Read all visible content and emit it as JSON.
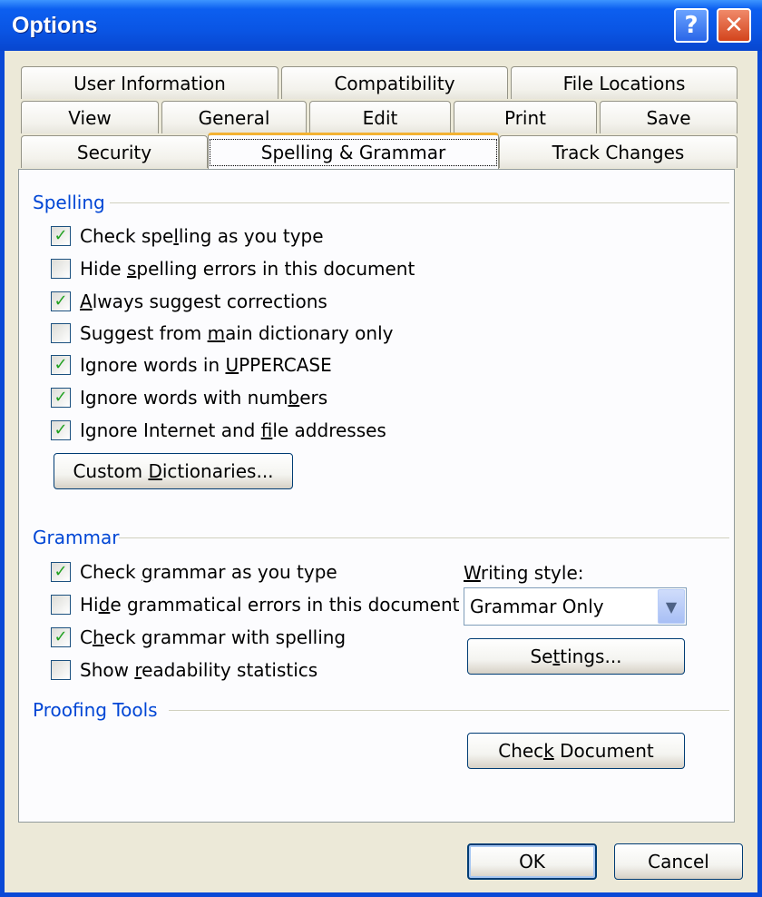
{
  "window": {
    "title": "Options"
  },
  "titlebar": {
    "help_glyph": "?",
    "close_glyph": "✕"
  },
  "tabs": {
    "row1": [
      "User Information",
      "Compatibility",
      "File Locations"
    ],
    "row2": [
      "View",
      "General",
      "Edit",
      "Print",
      "Save"
    ],
    "row3": [
      "Security",
      "Spelling & Grammar",
      "Track Changes"
    ],
    "active": "Spelling & Grammar"
  },
  "spelling": {
    "label": "Spelling",
    "options": [
      {
        "pre": "Check spe",
        "u": "l",
        "post": "ling as you type",
        "checked": true
      },
      {
        "pre": "Hide ",
        "u": "s",
        "post": "pelling errors in this document",
        "checked": false
      },
      {
        "pre": "",
        "u": "A",
        "post": "lways suggest corrections",
        "checked": true
      },
      {
        "pre": "Suggest from ",
        "u": "m",
        "post": "ain dictionary only",
        "checked": false
      },
      {
        "pre": "Ignore words in ",
        "u": "U",
        "post": "PPERCASE",
        "checked": true
      },
      {
        "pre": "Ignore words with num",
        "u": "b",
        "post": "ers",
        "checked": true
      },
      {
        "pre": "Ignore Internet and ",
        "u": "f",
        "post": "ile addresses",
        "checked": true
      }
    ],
    "custom_dictionaries": {
      "pre": "Custom ",
      "u": "D",
      "post": "ictionaries..."
    }
  },
  "grammar": {
    "label": "Grammar",
    "options": [
      {
        "pre": "Check ",
        "u": "g",
        "post": "rammar as you type",
        "checked": true
      },
      {
        "pre": "Hi",
        "u": "d",
        "post": "e grammatical errors in this document",
        "checked": false
      },
      {
        "pre": "C",
        "u": "h",
        "post": "eck grammar with spelling",
        "checked": true
      },
      {
        "pre": "Show ",
        "u": "r",
        "post": "eadability statistics",
        "checked": false
      }
    ],
    "writing_style": {
      "pre": "",
      "u": "W",
      "post": "riting style:"
    },
    "writing_style_value": "Grammar Only",
    "settings": {
      "pre": "Se",
      "u": "t",
      "post": "tings..."
    }
  },
  "proofing": {
    "label": "Proofing Tools",
    "check_document": {
      "pre": "Chec",
      "u": "k",
      "post": " Document"
    }
  },
  "footer": {
    "ok": "OK",
    "cancel": "Cancel"
  },
  "icons": {
    "check": "checkmark-icon",
    "arrow": "chevron-down-icon"
  },
  "colors": {
    "titlebar": "#0a55e4",
    "section_label": "#0046d5",
    "check": "#21a121",
    "face": "#ece9d8"
  }
}
